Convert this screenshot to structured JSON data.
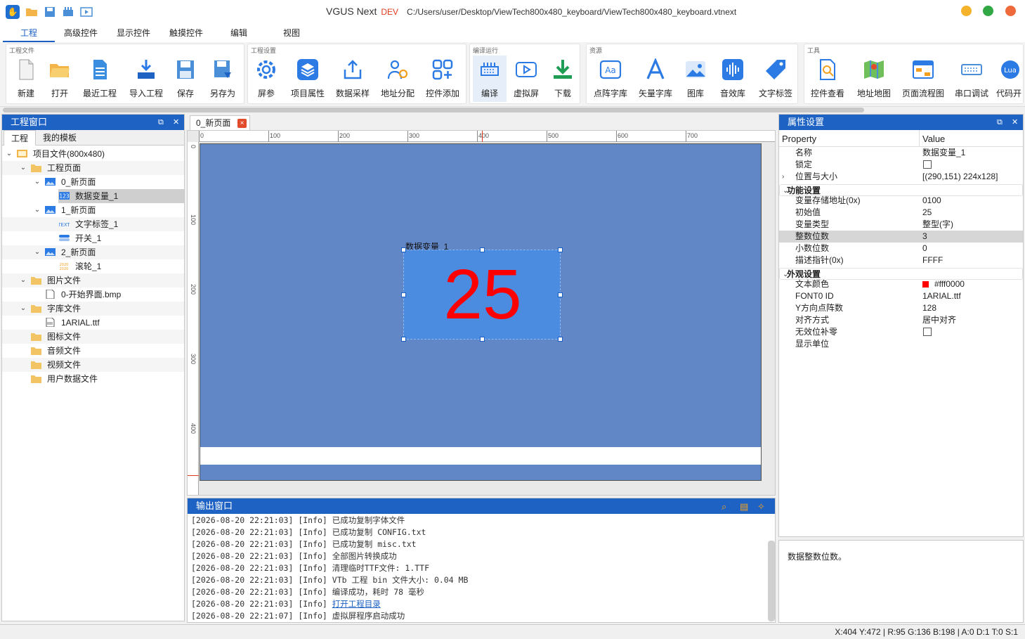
{
  "title": {
    "app": "VGUS Next",
    "badge": "DEV",
    "path": "C:/Users/user/Desktop/ViewTech800x480_keyboard/ViewTech800x480_keyboard.vtnext"
  },
  "menu": [
    "工程",
    "高级控件",
    "显示控件",
    "触摸控件",
    "编辑",
    "视图"
  ],
  "ribbon": {
    "g1_title": "工程文件",
    "g2_title": "工程设置",
    "g3_title": "编译运行",
    "g4_title": "资源",
    "g5_title": "工具",
    "g1": [
      "新建",
      "打开",
      "最近工程",
      "导入工程",
      "保存",
      "另存为"
    ],
    "g2": [
      "屏参",
      "项目属性",
      "数据采样",
      "地址分配",
      "控件添加"
    ],
    "g3": [
      "编译",
      "虚拟屏",
      "下载"
    ],
    "g4": [
      "点阵字库",
      "矢量字库",
      "图库",
      "音效库",
      "文字标签"
    ],
    "g5": [
      "控件查看",
      "地址地图",
      "页面流程图",
      "串口调试",
      "代码开"
    ],
    "g5_lua_label": "Lua"
  },
  "project": {
    "title": "工程窗口",
    "tabs": [
      "工程",
      "我的模板"
    ],
    "tree": [
      {
        "label": "项目文件(800x480)",
        "level": 0,
        "icon": "project-icon",
        "expanded": true
      },
      {
        "label": "工程页面",
        "level": 1,
        "icon": "folder-icon",
        "expanded": true
      },
      {
        "label": "0_新页面",
        "level": 2,
        "icon": "page-icon",
        "expanded": true
      },
      {
        "label": "数据变量_1",
        "level": 3,
        "icon": "number-var-icon",
        "selected": true
      },
      {
        "label": "1_新页面",
        "level": 2,
        "icon": "page-icon",
        "expanded": true
      },
      {
        "label": "文字标签_1",
        "level": 3,
        "icon": "text-label-icon"
      },
      {
        "label": "开关_1",
        "level": 3,
        "icon": "switch-icon"
      },
      {
        "label": "2_新页面",
        "level": 2,
        "icon": "page-icon",
        "expanded": true
      },
      {
        "label": "滚轮_1",
        "level": 3,
        "icon": "roller-icon"
      },
      {
        "label": "图片文件",
        "level": 1,
        "icon": "folder-icon",
        "expanded": true
      },
      {
        "label": "0-开始界面.bmp",
        "level": 2,
        "icon": "image-file-icon"
      },
      {
        "label": "字库文件",
        "level": 1,
        "icon": "folder-icon",
        "expanded": true
      },
      {
        "label": "1ARIAL.ttf",
        "level": 2,
        "icon": "font-file-icon"
      },
      {
        "label": "图标文件",
        "level": 1,
        "icon": "folder-icon"
      },
      {
        "label": "音频文件",
        "level": 1,
        "icon": "folder-icon"
      },
      {
        "label": "视频文件",
        "level": 1,
        "icon": "folder-icon"
      },
      {
        "label": "用户数据文件",
        "level": 1,
        "icon": "folder-icon"
      }
    ],
    "number_icon_text": "123",
    "text_icon_text": "TEXT",
    "roller_icon_text": "2020"
  },
  "doc": {
    "tab": "0_新页面",
    "close": "×"
  },
  "rulers": {
    "h": [
      "0",
      "100",
      "200",
      "300",
      "400",
      "500",
      "600",
      "700"
    ],
    "v": [
      "0",
      "100",
      "200",
      "300",
      "400"
    ]
  },
  "widget": {
    "name": "数据变量_1",
    "value": "25"
  },
  "output": {
    "title": "输出窗口",
    "lines": [
      "[2026-08-20 22:21:03] [Info] 已成功复制字体文件",
      "[2026-08-20 22:21:03] [Info] 已成功复制 CONFIG.txt",
      "[2026-08-20 22:21:03] [Info] 已成功复制 misc.txt",
      "[2026-08-20 22:21:03] [Info] 全部图片转换成功",
      "[2026-08-20 22:21:03] [Info] 清理临时TTF文件: 1.TTF",
      "[2026-08-20 22:21:03] [Info] VTb 工程 bin 文件大小: 0.04 MB",
      "[2026-08-20 22:21:03] [Info] 编译成功，耗时 78 毫秒"
    ],
    "link_prefix": "[2026-08-20 22:21:03] [Info] ",
    "link_text": "打开工程目录",
    "last_line": "[2026-08-20 22:21:07] [Info] 虚拟屏程序启动成功"
  },
  "props": {
    "title": "属性设置",
    "col_property": "Property",
    "col_value": "Value",
    "rows": [
      {
        "k": "名称",
        "v": "数据变量_1"
      },
      {
        "k": "锁定",
        "check": true
      },
      {
        "k": "位置与大小",
        "v": "[(290,151) 224x128]",
        "exp": "›"
      },
      {
        "k": "功能设置",
        "group": true,
        "exp": "⌄"
      },
      {
        "k": "变量存储地址(0x)",
        "v": "0100"
      },
      {
        "k": "初始值",
        "v": "25"
      },
      {
        "k": "变量类型",
        "v": "整型(字)"
      },
      {
        "k": "整数位数",
        "v": "3",
        "sel": true
      },
      {
        "k": "小数位数",
        "v": "0"
      },
      {
        "k": "描述指针(0x)",
        "v": "FFFF"
      },
      {
        "k": "外观设置",
        "group": true,
        "exp": "⌄"
      },
      {
        "k": "文本颜色",
        "v": "#fff0000",
        "swatch": true
      },
      {
        "k": "FONT0 ID",
        "v": "1ARIAL.ttf"
      },
      {
        "k": "Y方向点阵数",
        "v": "128"
      },
      {
        "k": "对齐方式",
        "v": "居中对齐"
      },
      {
        "k": "无效位补零",
        "check": true
      },
      {
        "k": "显示单位",
        "v": ""
      }
    ],
    "description": "数据整数位数。"
  },
  "status": "X:404  Y:472  |  R:95 G:136 B:198  |  A:0  D:1  T:0  S:1",
  "colors": {
    "accent": "#1e63c3",
    "stage": "#6187c6",
    "widget": "#4b8be0",
    "value": "#ff0000"
  }
}
